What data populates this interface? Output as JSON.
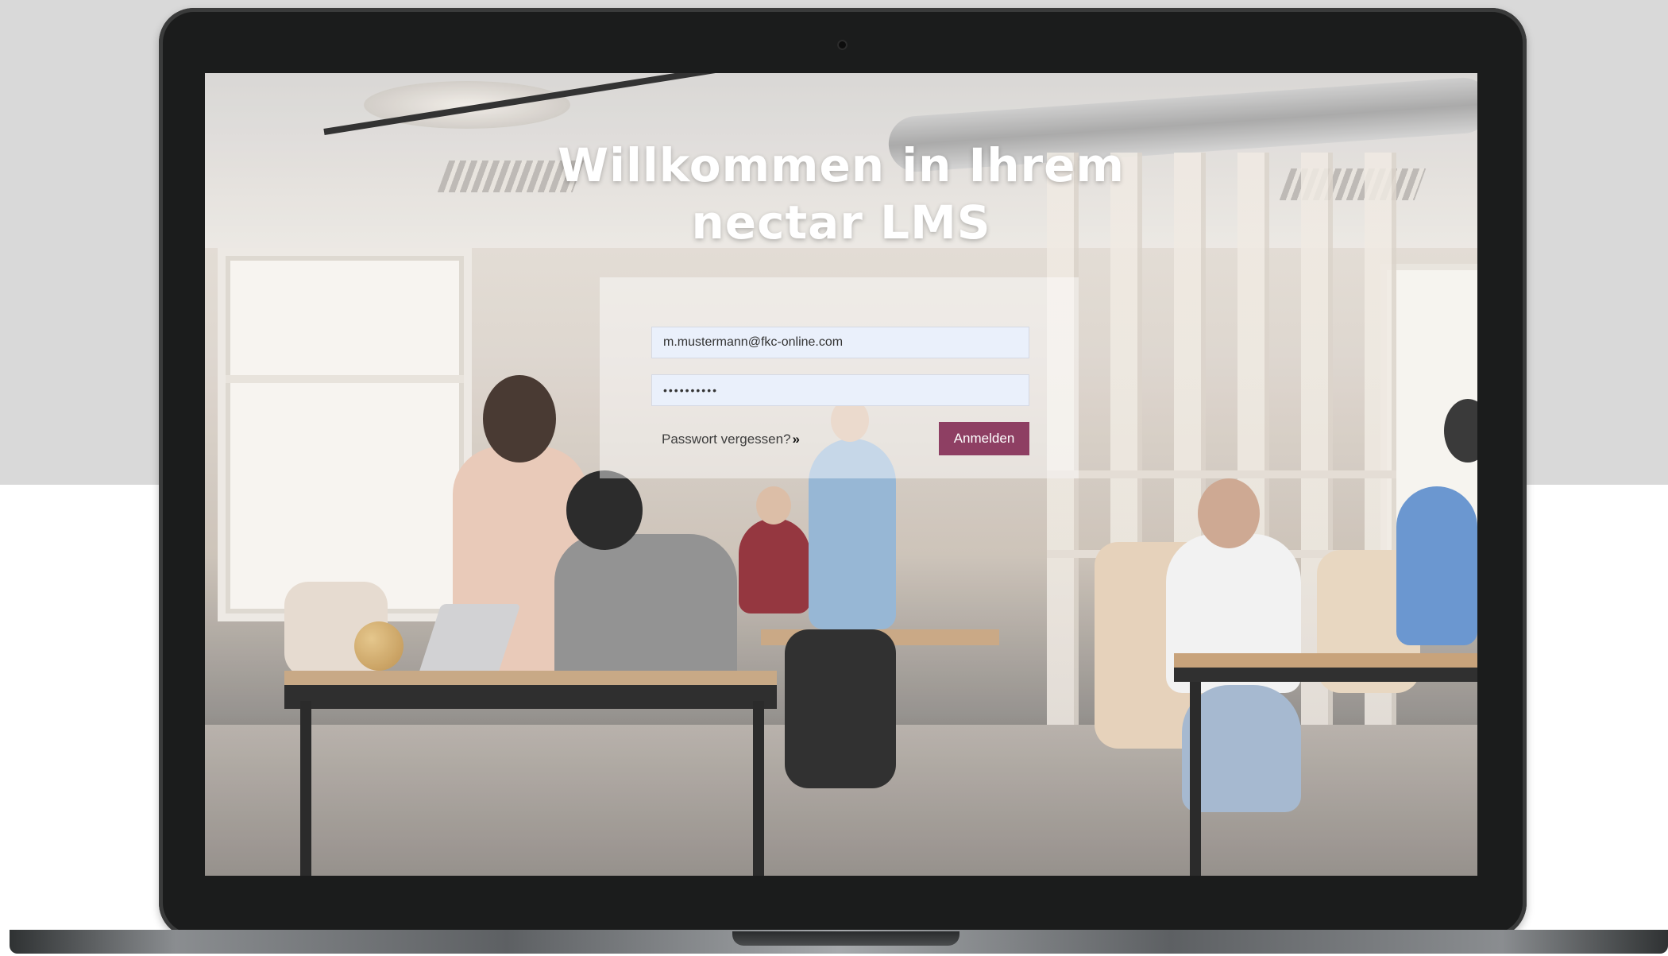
{
  "page": {
    "title_line1": "Willkommen in Ihrem",
    "title_line2": "nectar LMS"
  },
  "login": {
    "email_value": "m.mustermann@fkc-online.com",
    "password_value": "••••••••••",
    "forgot_label": "Passwort vergessen?",
    "forgot_icon": "»",
    "submit_label": "Anmelden"
  },
  "colors": {
    "accent": "#8e3f63",
    "input_bg": "#eaf0fb",
    "bezel": "#1b1c1c"
  }
}
